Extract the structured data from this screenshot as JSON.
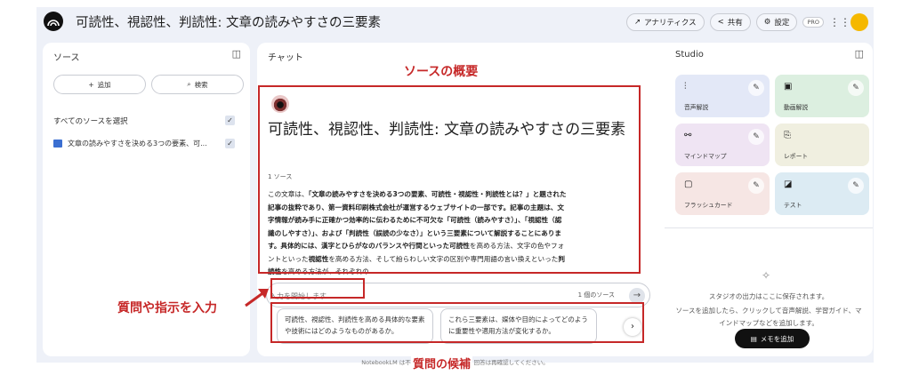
{
  "header": {
    "title": "可読性、視認性、判読性: 文章の読みやすさの三要素",
    "analytics": "アナリティクス",
    "share": "共有",
    "settings": "設定",
    "pro": "PRO"
  },
  "sources": {
    "title": "ソース",
    "add": "追加",
    "search": "検索",
    "select_all": "すべてのソースを選択",
    "item": "文章の読みやすさを決める3つの要素、可..."
  },
  "chat": {
    "title": "チャット",
    "doc_title": "可読性、視認性、判読性: 文章の読みやすさの三要素",
    "source_count": "1 ソース",
    "summary": [
      {
        "t": "この文章は、",
        "b": false
      },
      {
        "t": "「文章の読みやすさを決める3つの要素、可読性・視認性・判読性とは？」と題された記事の抜粋であり、第一資料印刷株式会社が運営するウェブサイトの一部です。記事の主題は、文字情報が読み手に正確かつ効率的に伝わるために不可欠な「可読性（読みやすさ）」、「視認性（認識のしやすさ）」、および「判読性（誤読の少なさ）」という三要素について解説することにあります。具体的には、漢字とひらがなのバランスや行間といった可読性",
        "b": true
      },
      {
        "t": "を高める方法、文字の色やフォントといった",
        "b": false
      },
      {
        "t": "視認性",
        "b": true
      },
      {
        "t": "を高める方法、そして紛らわしい文字の区別や専門用語の言い換えといった",
        "b": false
      },
      {
        "t": "判読性",
        "b": true
      },
      {
        "t": "を高める方法が、それぞれの",
        "b": false
      }
    ],
    "input_placeholder": "入力を開始します...",
    "input_source_count": "1 個のソース",
    "suggestions": [
      "可読性、視認性、判読性を高める具体的な要素や技術にはどのようなものがあるか。",
      "これら三要素は、媒体や目的によってどのように重要性や適用方法が変化するか。"
    ],
    "footer": "NotebookLM は不正確な場合があります。回答は再確認してください。"
  },
  "studio": {
    "title": "Studio",
    "tiles": [
      {
        "label": "音声解説",
        "icon": "audio-wave-icon",
        "color": "#e3e8f7"
      },
      {
        "label": "動画解説",
        "icon": "video-icon",
        "color": "#dcefe0"
      },
      {
        "label": "マインドマップ",
        "icon": "mind-map-icon",
        "color": "#efe4f3"
      },
      {
        "label": "レポート",
        "icon": "report-icon",
        "color": "#f0efe0"
      },
      {
        "label": "フラッシュカード",
        "icon": "flashcard-icon",
        "color": "#f6e6e4"
      },
      {
        "label": "テスト",
        "icon": "quiz-icon",
        "color": "#dcebf3"
      }
    ],
    "empty_msg1": "スタジオの出力はここに保存されます。",
    "empty_msg2": "ソースを追加したら、クリックして音声解説、学習ガイド、マインドマップなどを追加します。",
    "add_note": "メモを追加"
  },
  "annotations": {
    "overview": "ソースの概要",
    "input": "質問や指示を入力",
    "candidates": "質問の候補",
    "color": "#c62828"
  }
}
